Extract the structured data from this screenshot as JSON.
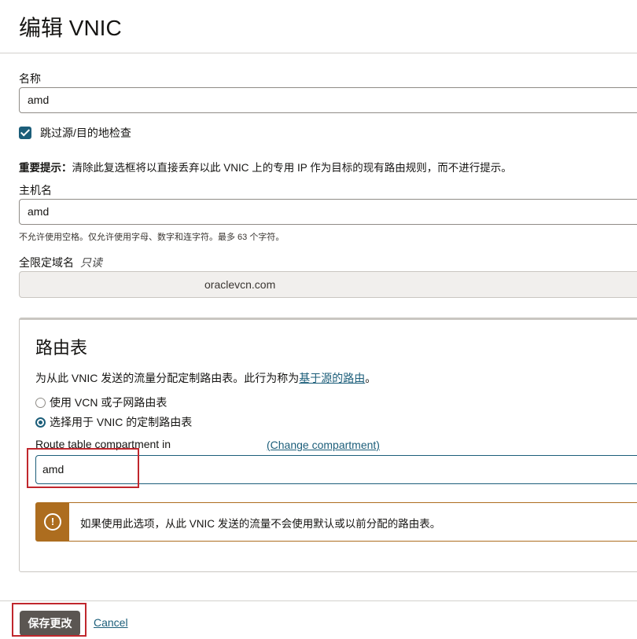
{
  "header": {
    "title": "编辑 VNIC"
  },
  "form": {
    "name_label": "名称",
    "name_value": "amd",
    "skip_check_label": "跳过源/目的地检查",
    "important_prefix": "重要提示：",
    "important_text": "清除此复选框将以直接丢弃以此 VNIC 上的专用 IP 作为目标的现有路由规则，而不进行提示。",
    "hostname_label": "主机名",
    "hostname_value": "amd",
    "hostname_help": "不允许使用空格。仅允许使用字母、数字和连字符。最多 63 个字符。",
    "fqdn_label": "全限定域名",
    "fqdn_readonly_tag": "只读",
    "fqdn_value": "oraclevcn.com"
  },
  "route_panel": {
    "title": "路由表",
    "desc_before": "为从此 VNIC 发送的流量分配定制路由表。此行为称为",
    "desc_link": "基于源的路由",
    "desc_after": "。",
    "option1": "使用 VCN 或子网路由表",
    "option2": "选择用于 VNIC 的定制路由表",
    "selected_option": "option2",
    "compartment_label": "Route table compartment in",
    "change_compartment": "(Change compartment)",
    "compartment_value": "amd",
    "warning_icon": "!",
    "warning_text": "如果使用此选项，从此 VNIC 发送的流量不会使用默认或以前分配的路由表。"
  },
  "footer": {
    "save_label": "保存更改",
    "cancel_label": "Cancel"
  },
  "colors": {
    "accent": "#1c5e7a",
    "warning": "#ad6d1f",
    "highlight": "#c0272d",
    "save_button": "#5b5652"
  },
  "icons": {
    "checkbox": "checkmark-icon",
    "warning": "exclamation-circle-icon"
  }
}
